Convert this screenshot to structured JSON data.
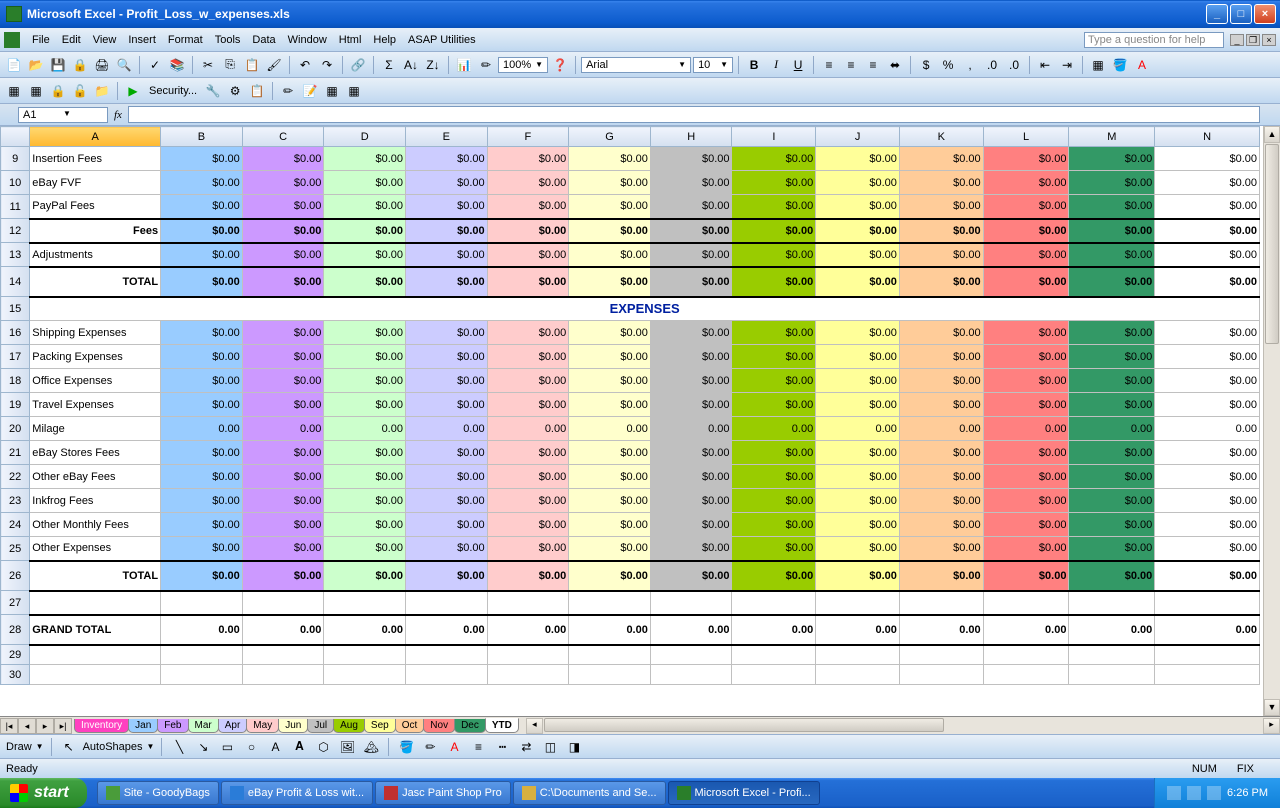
{
  "window": {
    "title": "Microsoft Excel - Profit_Loss_w_expenses.xls"
  },
  "menus": [
    "File",
    "Edit",
    "View",
    "Insert",
    "Format",
    "Tools",
    "Data",
    "Window",
    "Html",
    "Help",
    "ASAP Utilities"
  ],
  "helpPlaceholder": "Type a question for help",
  "namebox": "A1",
  "toolbar": {
    "securityLabel": "Security...",
    "zoom": "100%",
    "font": "Arial",
    "fontSize": "10"
  },
  "columns": [
    "A",
    "B",
    "C",
    "D",
    "E",
    "F",
    "G",
    "H",
    "I",
    "J",
    "K",
    "L",
    "M",
    "N"
  ],
  "colClasses": [
    "",
    "cB",
    "cC",
    "cD",
    "cE",
    "cF",
    "cG",
    "cH",
    "cI",
    "cJ",
    "cK",
    "cL",
    "cM",
    "cN"
  ],
  "sectionHeader": "EXPENSES",
  "rows": [
    {
      "num": 9,
      "label": "Insertion Fees",
      "bold": false,
      "vals": [
        "$0.00",
        "$0.00",
        "$0.00",
        "$0.00",
        "$0.00",
        "$0.00",
        "$0.00",
        "$0.00",
        "$0.00",
        "$0.00",
        "$0.00",
        "$0.00",
        "$0.00"
      ]
    },
    {
      "num": 10,
      "label": "eBay FVF",
      "bold": false,
      "vals": [
        "$0.00",
        "$0.00",
        "$0.00",
        "$0.00",
        "$0.00",
        "$0.00",
        "$0.00",
        "$0.00",
        "$0.00",
        "$0.00",
        "$0.00",
        "$0.00",
        "$0.00"
      ]
    },
    {
      "num": 11,
      "label": "PayPal Fees",
      "bold": false,
      "vals": [
        "$0.00",
        "$0.00",
        "$0.00",
        "$0.00",
        "$0.00",
        "$0.00",
        "$0.00",
        "$0.00",
        "$0.00",
        "$0.00",
        "$0.00",
        "$0.00",
        "$0.00"
      ]
    },
    {
      "num": 12,
      "label": "Fees",
      "bold": true,
      "labelRight": true,
      "vals": [
        "$0.00",
        "$0.00",
        "$0.00",
        "$0.00",
        "$0.00",
        "$0.00",
        "$0.00",
        "$0.00",
        "$0.00",
        "$0.00",
        "$0.00",
        "$0.00",
        "$0.00"
      ],
      "thickTop": true,
      "thickBot": true
    },
    {
      "num": 13,
      "label": "Adjustments",
      "bold": false,
      "vals": [
        "$0.00",
        "$0.00",
        "$0.00",
        "$0.00",
        "$0.00",
        "$0.00",
        "$0.00",
        "$0.00",
        "$0.00",
        "$0.00",
        "$0.00",
        "$0.00",
        "$0.00"
      ]
    },
    {
      "num": 14,
      "label": "TOTAL",
      "bold": true,
      "labelRight": true,
      "tall": true,
      "vals": [
        "$0.00",
        "$0.00",
        "$0.00",
        "$0.00",
        "$0.00",
        "$0.00",
        "$0.00",
        "$0.00",
        "$0.00",
        "$0.00",
        "$0.00",
        "$0.00",
        "$0.00"
      ],
      "thickTop": true,
      "thickBot": true
    },
    {
      "num": 15,
      "section": true
    },
    {
      "num": 16,
      "label": "Shipping Expenses",
      "bold": false,
      "vals": [
        "$0.00",
        "$0.00",
        "$0.00",
        "$0.00",
        "$0.00",
        "$0.00",
        "$0.00",
        "$0.00",
        "$0.00",
        "$0.00",
        "$0.00",
        "$0.00",
        "$0.00"
      ]
    },
    {
      "num": 17,
      "label": "Packing Expenses",
      "bold": false,
      "vals": [
        "$0.00",
        "$0.00",
        "$0.00",
        "$0.00",
        "$0.00",
        "$0.00",
        "$0.00",
        "$0.00",
        "$0.00",
        "$0.00",
        "$0.00",
        "$0.00",
        "$0.00"
      ]
    },
    {
      "num": 18,
      "label": "Office Expenses",
      "bold": false,
      "vals": [
        "$0.00",
        "$0.00",
        "$0.00",
        "$0.00",
        "$0.00",
        "$0.00",
        "$0.00",
        "$0.00",
        "$0.00",
        "$0.00",
        "$0.00",
        "$0.00",
        "$0.00"
      ]
    },
    {
      "num": 19,
      "label": "Travel Expenses",
      "bold": false,
      "vals": [
        "$0.00",
        "$0.00",
        "$0.00",
        "$0.00",
        "$0.00",
        "$0.00",
        "$0.00",
        "$0.00",
        "$0.00",
        "$0.00",
        "$0.00",
        "$0.00",
        "$0.00"
      ]
    },
    {
      "num": 20,
      "label": "Milage",
      "bold": false,
      "vals": [
        "0.00",
        "0.00",
        "0.00",
        "0.00",
        "0.00",
        "0.00",
        "0.00",
        "0.00",
        "0.00",
        "0.00",
        "0.00",
        "0.00",
        "0.00"
      ]
    },
    {
      "num": 21,
      "label": "eBay Stores Fees",
      "bold": false,
      "vals": [
        "$0.00",
        "$0.00",
        "$0.00",
        "$0.00",
        "$0.00",
        "$0.00",
        "$0.00",
        "$0.00",
        "$0.00",
        "$0.00",
        "$0.00",
        "$0.00",
        "$0.00"
      ]
    },
    {
      "num": 22,
      "label": "Other eBay Fees",
      "bold": false,
      "vals": [
        "$0.00",
        "$0.00",
        "$0.00",
        "$0.00",
        "$0.00",
        "$0.00",
        "$0.00",
        "$0.00",
        "$0.00",
        "$0.00",
        "$0.00",
        "$0.00",
        "$0.00"
      ]
    },
    {
      "num": 23,
      "label": "Inkfrog Fees",
      "bold": false,
      "vals": [
        "$0.00",
        "$0.00",
        "$0.00",
        "$0.00",
        "$0.00",
        "$0.00",
        "$0.00",
        "$0.00",
        "$0.00",
        "$0.00",
        "$0.00",
        "$0.00",
        "$0.00"
      ]
    },
    {
      "num": 24,
      "label": "Other Monthly Fees",
      "bold": false,
      "vals": [
        "$0.00",
        "$0.00",
        "$0.00",
        "$0.00",
        "$0.00",
        "$0.00",
        "$0.00",
        "$0.00",
        "$0.00",
        "$0.00",
        "$0.00",
        "$0.00",
        "$0.00"
      ]
    },
    {
      "num": 25,
      "label": "Other Expenses",
      "bold": false,
      "vals": [
        "$0.00",
        "$0.00",
        "$0.00",
        "$0.00",
        "$0.00",
        "$0.00",
        "$0.00",
        "$0.00",
        "$0.00",
        "$0.00",
        "$0.00",
        "$0.00",
        "$0.00"
      ]
    },
    {
      "num": 26,
      "label": "TOTAL",
      "bold": true,
      "labelRight": true,
      "tall": true,
      "vals": [
        "$0.00",
        "$0.00",
        "$0.00",
        "$0.00",
        "$0.00",
        "$0.00",
        "$0.00",
        "$0.00",
        "$0.00",
        "$0.00",
        "$0.00",
        "$0.00",
        "$0.00"
      ],
      "thickTop": true,
      "thickBot": true
    },
    {
      "num": 27,
      "label": "",
      "bold": false,
      "vals": [
        "",
        "",
        "",
        "",
        "",
        "",
        "",
        "",
        "",
        "",
        "",
        "",
        ""
      ],
      "noColor": true
    },
    {
      "num": 28,
      "label": "GRAND TOTAL",
      "bold": true,
      "tall": true,
      "vals": [
        "0.00",
        "0.00",
        "0.00",
        "0.00",
        "0.00",
        "0.00",
        "0.00",
        "0.00",
        "0.00",
        "0.00",
        "0.00",
        "0.00",
        "0.00"
      ],
      "noColor": true,
      "thickTop": true,
      "thickBot": true
    },
    {
      "num": 29,
      "label": "",
      "bold": false,
      "vals": [
        "",
        "",
        "",
        "",
        "",
        "",
        "",
        "",
        "",
        "",
        "",
        "",
        ""
      ],
      "noColor": true,
      "short": true
    },
    {
      "num": 30,
      "label": "",
      "bold": false,
      "vals": [
        "",
        "",
        "",
        "",
        "",
        "",
        "",
        "",
        "",
        "",
        "",
        "",
        ""
      ],
      "noColor": true,
      "short": true
    }
  ],
  "sheetTabs": [
    {
      "name": "Inventory",
      "color": "#ff40c0"
    },
    {
      "name": "Jan",
      "color": "#99ccff"
    },
    {
      "name": "Feb",
      "color": "#cc99ff"
    },
    {
      "name": "Mar",
      "color": "#ccffcc"
    },
    {
      "name": "Apr",
      "color": "#ccccff"
    },
    {
      "name": "May",
      "color": "#ffcccc"
    },
    {
      "name": "Jun",
      "color": "#ffffcc"
    },
    {
      "name": "Jul",
      "color": "#c0c0c0"
    },
    {
      "name": "Aug",
      "color": "#99cc00"
    },
    {
      "name": "Sep",
      "color": "#ffff99"
    },
    {
      "name": "Oct",
      "color": "#ffcc99"
    },
    {
      "name": "Nov",
      "color": "#ff8080"
    },
    {
      "name": "Dec",
      "color": "#339966"
    },
    {
      "name": "YTD",
      "color": "#ffffff",
      "active": true
    }
  ],
  "draw": {
    "label": "Draw",
    "autoshapes": "AutoShapes"
  },
  "status": {
    "ready": "Ready",
    "num": "NUM",
    "fix": "FIX"
  },
  "taskbar": {
    "start": "start",
    "buttons": [
      {
        "label": "Site - GoodyBags",
        "color": "#4a9c3a"
      },
      {
        "label": "eBay Profit & Loss wit...",
        "color": "#2a7cd8"
      },
      {
        "label": "Jasc Paint Shop Pro",
        "color": "#c03030"
      },
      {
        "label": "C:\\Documents and Se...",
        "color": "#d8b040"
      },
      {
        "label": "Microsoft Excel - Profi...",
        "color": "#2a7e2a",
        "active": true
      }
    ],
    "clock": "6:26 PM"
  }
}
